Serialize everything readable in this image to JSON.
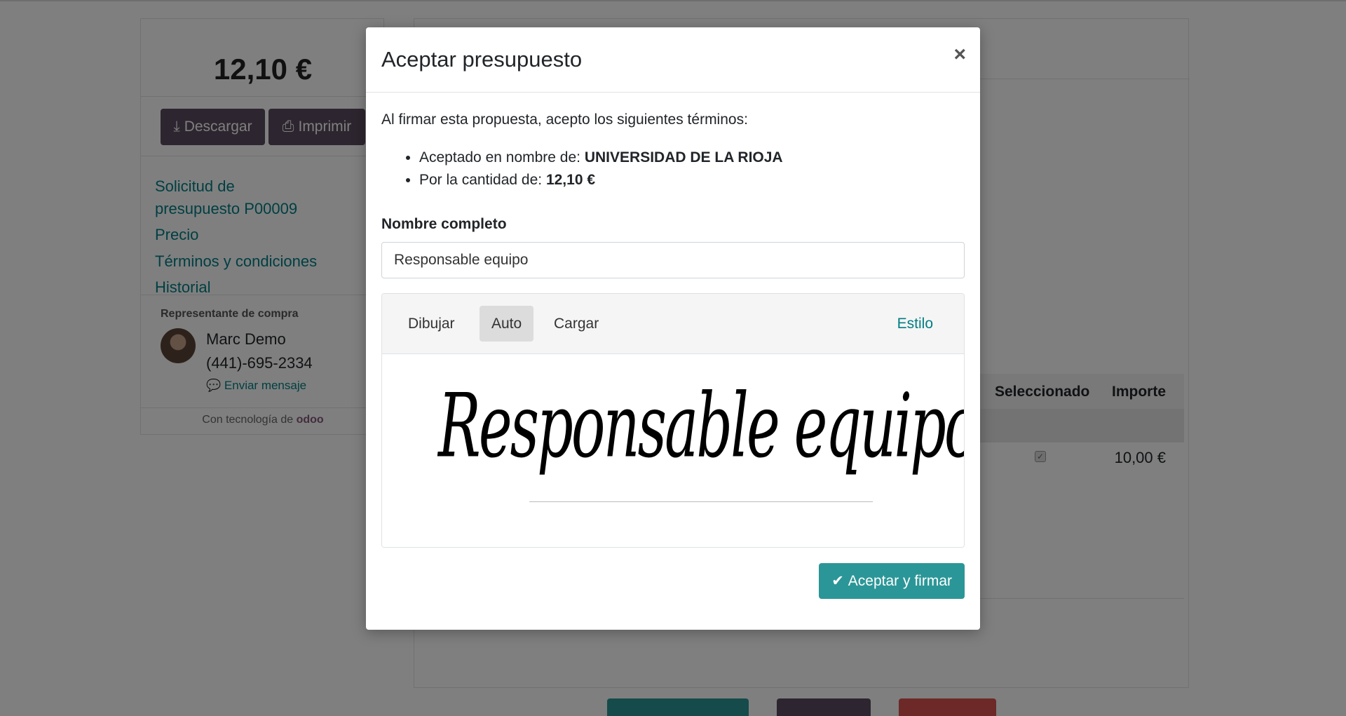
{
  "sidebar": {
    "total": "12,10 €",
    "download_label": "Descargar",
    "print_label": "Imprimir",
    "nav": [
      "Solicitud de",
      "presupuesto P00009",
      "Precio",
      "Términos y condiciones",
      "Historial"
    ],
    "rep_label": "Representante de compra",
    "rep_name": "Marc Demo",
    "rep_phone": "(441)-695-2334",
    "rep_message": "Enviar mensaje",
    "powered_prefix": "Con tecnología de",
    "powered_brand": "odoo"
  },
  "table": {
    "col_selected": "Seleccionado",
    "col_amount": "Importe",
    "row_amount": "10,00 €"
  },
  "modal": {
    "title": "Aceptar presupuesto",
    "close": "×",
    "intro": "Al firmar esta propuesta, acepto los siguientes términos:",
    "terms": {
      "on_behalf_label": "Aceptado en nombre de: ",
      "on_behalf_value": "UNIVERSIDAD DE LA RIOJA",
      "amount_label": "Por la cantidad de: ",
      "amount_value": "12,10 €"
    },
    "name_label": "Nombre completo",
    "name_value": "Responsable equipo",
    "tabs": [
      "Dibujar",
      "Auto",
      "Cargar"
    ],
    "active_tab": "Auto",
    "style_label": "Estilo",
    "signature_text": "Responsable equipo",
    "accept_label": "Aceptar y firmar"
  },
  "colors": {
    "accent": "#017e84",
    "primary_button": "#2b9697",
    "dark_button": "#5a4a5f"
  }
}
